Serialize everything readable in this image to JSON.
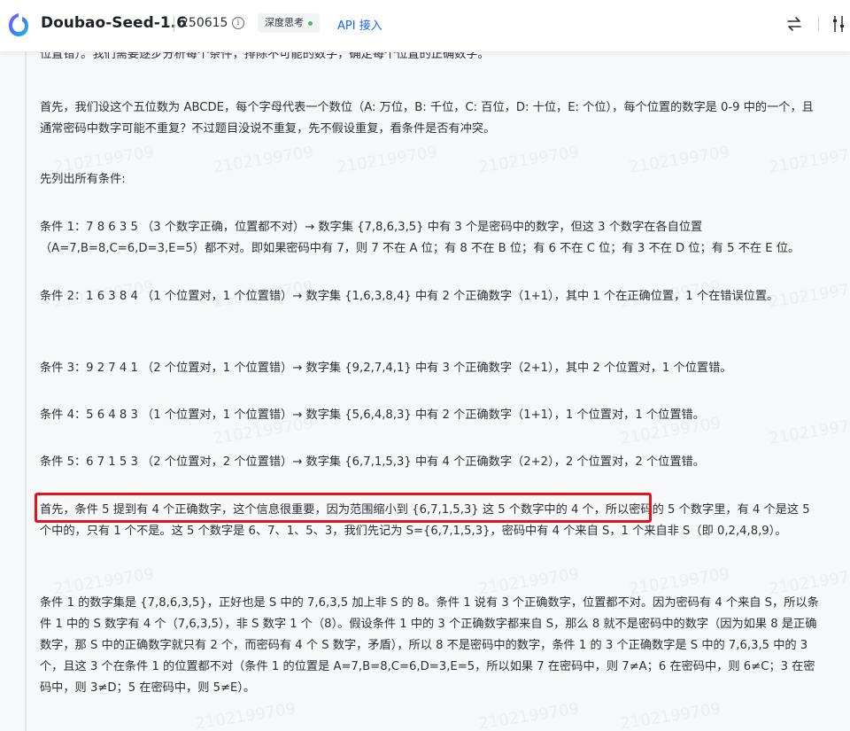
{
  "header": {
    "model_name": "Doubao-Seed-1.6",
    "version": "250615",
    "info_glyph": "i",
    "badge_label": "深度思考",
    "api_link": "API 接入",
    "accent_color": "#1664ff",
    "icons": [
      "doubao-logo-icon",
      "info-icon",
      "status-dot-icon",
      "swap-icon",
      "sliders-icon"
    ]
  },
  "watermark_text": "2102199709",
  "paragraphs": [
    "位置错）。我们需要逐步分析每个条件，排除不可能的数字，确定每个位置的正确数字。",
    "首先，我们设这个五位数为 ABCDE，每个字母代表一个数位（A: 万位，B: 千位，C: 百位，D: 十位，E: 个位），每个位置的数字是 0-9 中的一个，且通常密码中数字可能不重复？不过题目没说不重复，先不假设重复，看条件是否有冲突。",
    "先列出所有条件:",
    "条件 1：7 8 6 3 5 （3 个数字正确，位置都不对）→ 数字集 {7,8,6,3,5} 中有 3 个是密码中的数字，但这 3 个数字在各自位置（A=7,B=8,C=6,D=3,E=5）都不对。即如果密码中有 7，则 7 不在 A 位；有 8 不在 B 位；有 6 不在 C 位；有 3 不在 D 位；有 5 不在 E 位。",
    "条件 2：1 6 3 8 4 （1 个位置对，1 个位置错）→ 数字集 {1,6,3,8,4} 中有 2 个正确数字（1+1），其中 1 个在正确位置，1 个在错误位置。",
    "条件 3：9 2 7 4 1 （2 个位置对，1 个位置错）→ 数字集 {9,2,7,4,1} 中有 3 个正确数字（2+1），其中 2 个位置对，1 个位置错。",
    "条件 4：5 6 4 8 3 （1 个位置对，1 个位置错）→ 数字集 {5,6,4,8,3} 中有 2 个正确数字（1+1），1 个位置对，1 个位置错。",
    "条件 5：6 7 1 5 3 （2 个位置对，2 个位置错）→ 数字集 {6,7,1,5,3} 中有 4 个正确数字（2+2），2 个位置对，2 个位置错。",
    "首先，条件 5 提到有 4 个正确数字，这个信息很重要，因为范围缩小到 {6,7,1,5,3} 这 5 个数字中的 4 个，所以密码的 5 个数字里，有 4 个是这 5 个中的，只有 1 个不是。这 5 个数字是 6、7、1、5、3，我们先记为 S={6,7,1,5,3}，密码中有 4 个来自 S，1 个来自非 S（即 0,2,4,8,9）。",
    "条件 1 的数字集是 {7,8,6,3,5}，正好也是 S 中的 7,6,3,5 加上非 S 的 8。条件 1 说有 3 个正确数字，位置都不对。因为密码有 4 个来自 S，所以条件 1 中的 S 数字有 4 个（7,6,3,5），非 S 数字 1 个（8）。假设条件 1 中的 3 个正确数字都来自 S，那么 8 就不是密码中的数字（因为如果 8 是正确数字，那 S 中的正确数字就只有 2 个，而密码有 4 个 S 数字，矛盾），所以 8 不是密码中的数字，条件 1 的 3 个正确数字是 S 中的 7,6,3,5 中的 3 个，且这 3 个在条件 1 的位置都不对（条件 1 的位置是 A=7,B=8,C=6,D=3,E=5，所以如果 7 在密码中，则 7≠A；6 在密码中，则 6≠C；3 在密码中，则 3≠D；5 在密码中，则 5≠E）。"
  ],
  "highlight_color": "#e8121a"
}
